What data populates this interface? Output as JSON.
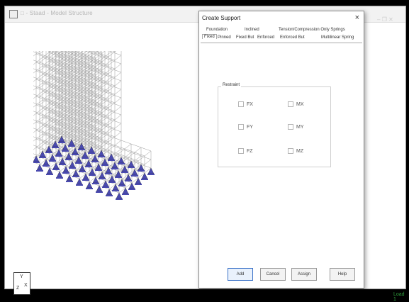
{
  "window": {
    "title": "□ - Staad - Model Structure",
    "controls": [
      "–",
      "❐",
      "✕"
    ]
  },
  "viewport": {
    "axis": {
      "x": "X",
      "y": "Y",
      "z": "Z"
    },
    "status": "Load 1"
  },
  "dialog": {
    "title": "Create Support",
    "close": "×",
    "tabs_row1": [
      "Foundation",
      "Inclined",
      "Tension/Compression Only Springs"
    ],
    "tabs_row2": [
      "Fixed",
      "Pinned",
      "Fixed But",
      "Enforced",
      "Enforced But",
      "Multilinear Spring"
    ],
    "active_tab": "Fixed",
    "group_label": "Restraint",
    "checks": [
      {
        "label": "FX"
      },
      {
        "label": "MX"
      },
      {
        "label": "FY"
      },
      {
        "label": "MY"
      },
      {
        "label": "FZ"
      },
      {
        "label": "MZ"
      }
    ],
    "buttons": {
      "add": "Add",
      "cancel": "Cancel",
      "assign": "Assign",
      "help": "Help"
    }
  },
  "colors": {
    "accent": "#3a72c8",
    "support": "#4a4ab0",
    "grid": "#9a9a9a"
  }
}
